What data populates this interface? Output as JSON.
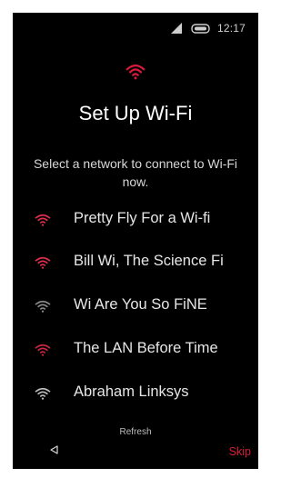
{
  "colors": {
    "background": "#000000",
    "accent": "#d81b3a",
    "text": "#ffffff",
    "network_strong": "#e0304a",
    "network_medium": "#c92840",
    "network_weak": "#8a8a8a"
  },
  "status_bar": {
    "time": "12:17",
    "icons": [
      "signal-icon",
      "battery-icon"
    ]
  },
  "header": {
    "icon": "wifi-icon",
    "title": "Set Up Wi-Fi",
    "subtitle": "Select a network to connect to Wi-Fi now."
  },
  "networks": [
    {
      "name": "Pretty Fly For a Wi-fi",
      "icon": "wifi-icon",
      "icon_color": "#e0304a"
    },
    {
      "name": "Bill Wi, The Science Fi",
      "icon": "wifi-icon",
      "icon_color": "#e0304a"
    },
    {
      "name": "Wi Are You So FiNE",
      "icon": "wifi-icon",
      "icon_color": "#8a8a8a"
    },
    {
      "name": "The LAN Before Time",
      "icon": "wifi-icon",
      "icon_color": "#c92840"
    },
    {
      "name": "Abraham Linksys",
      "icon": "wifi-icon",
      "icon_color": "#bcbcbc"
    }
  ],
  "footer": {
    "refresh_label": "Refresh",
    "back_icon": "back-triangle-icon",
    "skip_label": "Skip"
  }
}
